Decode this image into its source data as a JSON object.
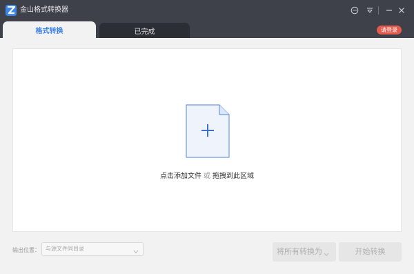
{
  "window": {
    "title": "金山格式转换器",
    "logo_letter": "Z",
    "controls": [
      "feedback-icon",
      "menu-icon",
      "minimize-icon",
      "close-icon"
    ]
  },
  "tabs": [
    {
      "label": "格式转换",
      "active": true
    },
    {
      "label": "已完成",
      "active": false
    }
  ],
  "login": {
    "label": "请登录",
    "color": "#e25b4e"
  },
  "dropzone": {
    "icon": "add-file-icon",
    "hint_add": "点击添加文件",
    "hint_or": "或",
    "hint_drag": "拖拽到此区域"
  },
  "output": {
    "label": "输出位置：",
    "selected": "与源文件同目录"
  },
  "actions": {
    "convert_all": "将所有转换为",
    "start": "开始转换"
  },
  "colors": {
    "titlebar": "#3e4149",
    "accent": "#3f83ea",
    "login": "#e25b4e"
  }
}
